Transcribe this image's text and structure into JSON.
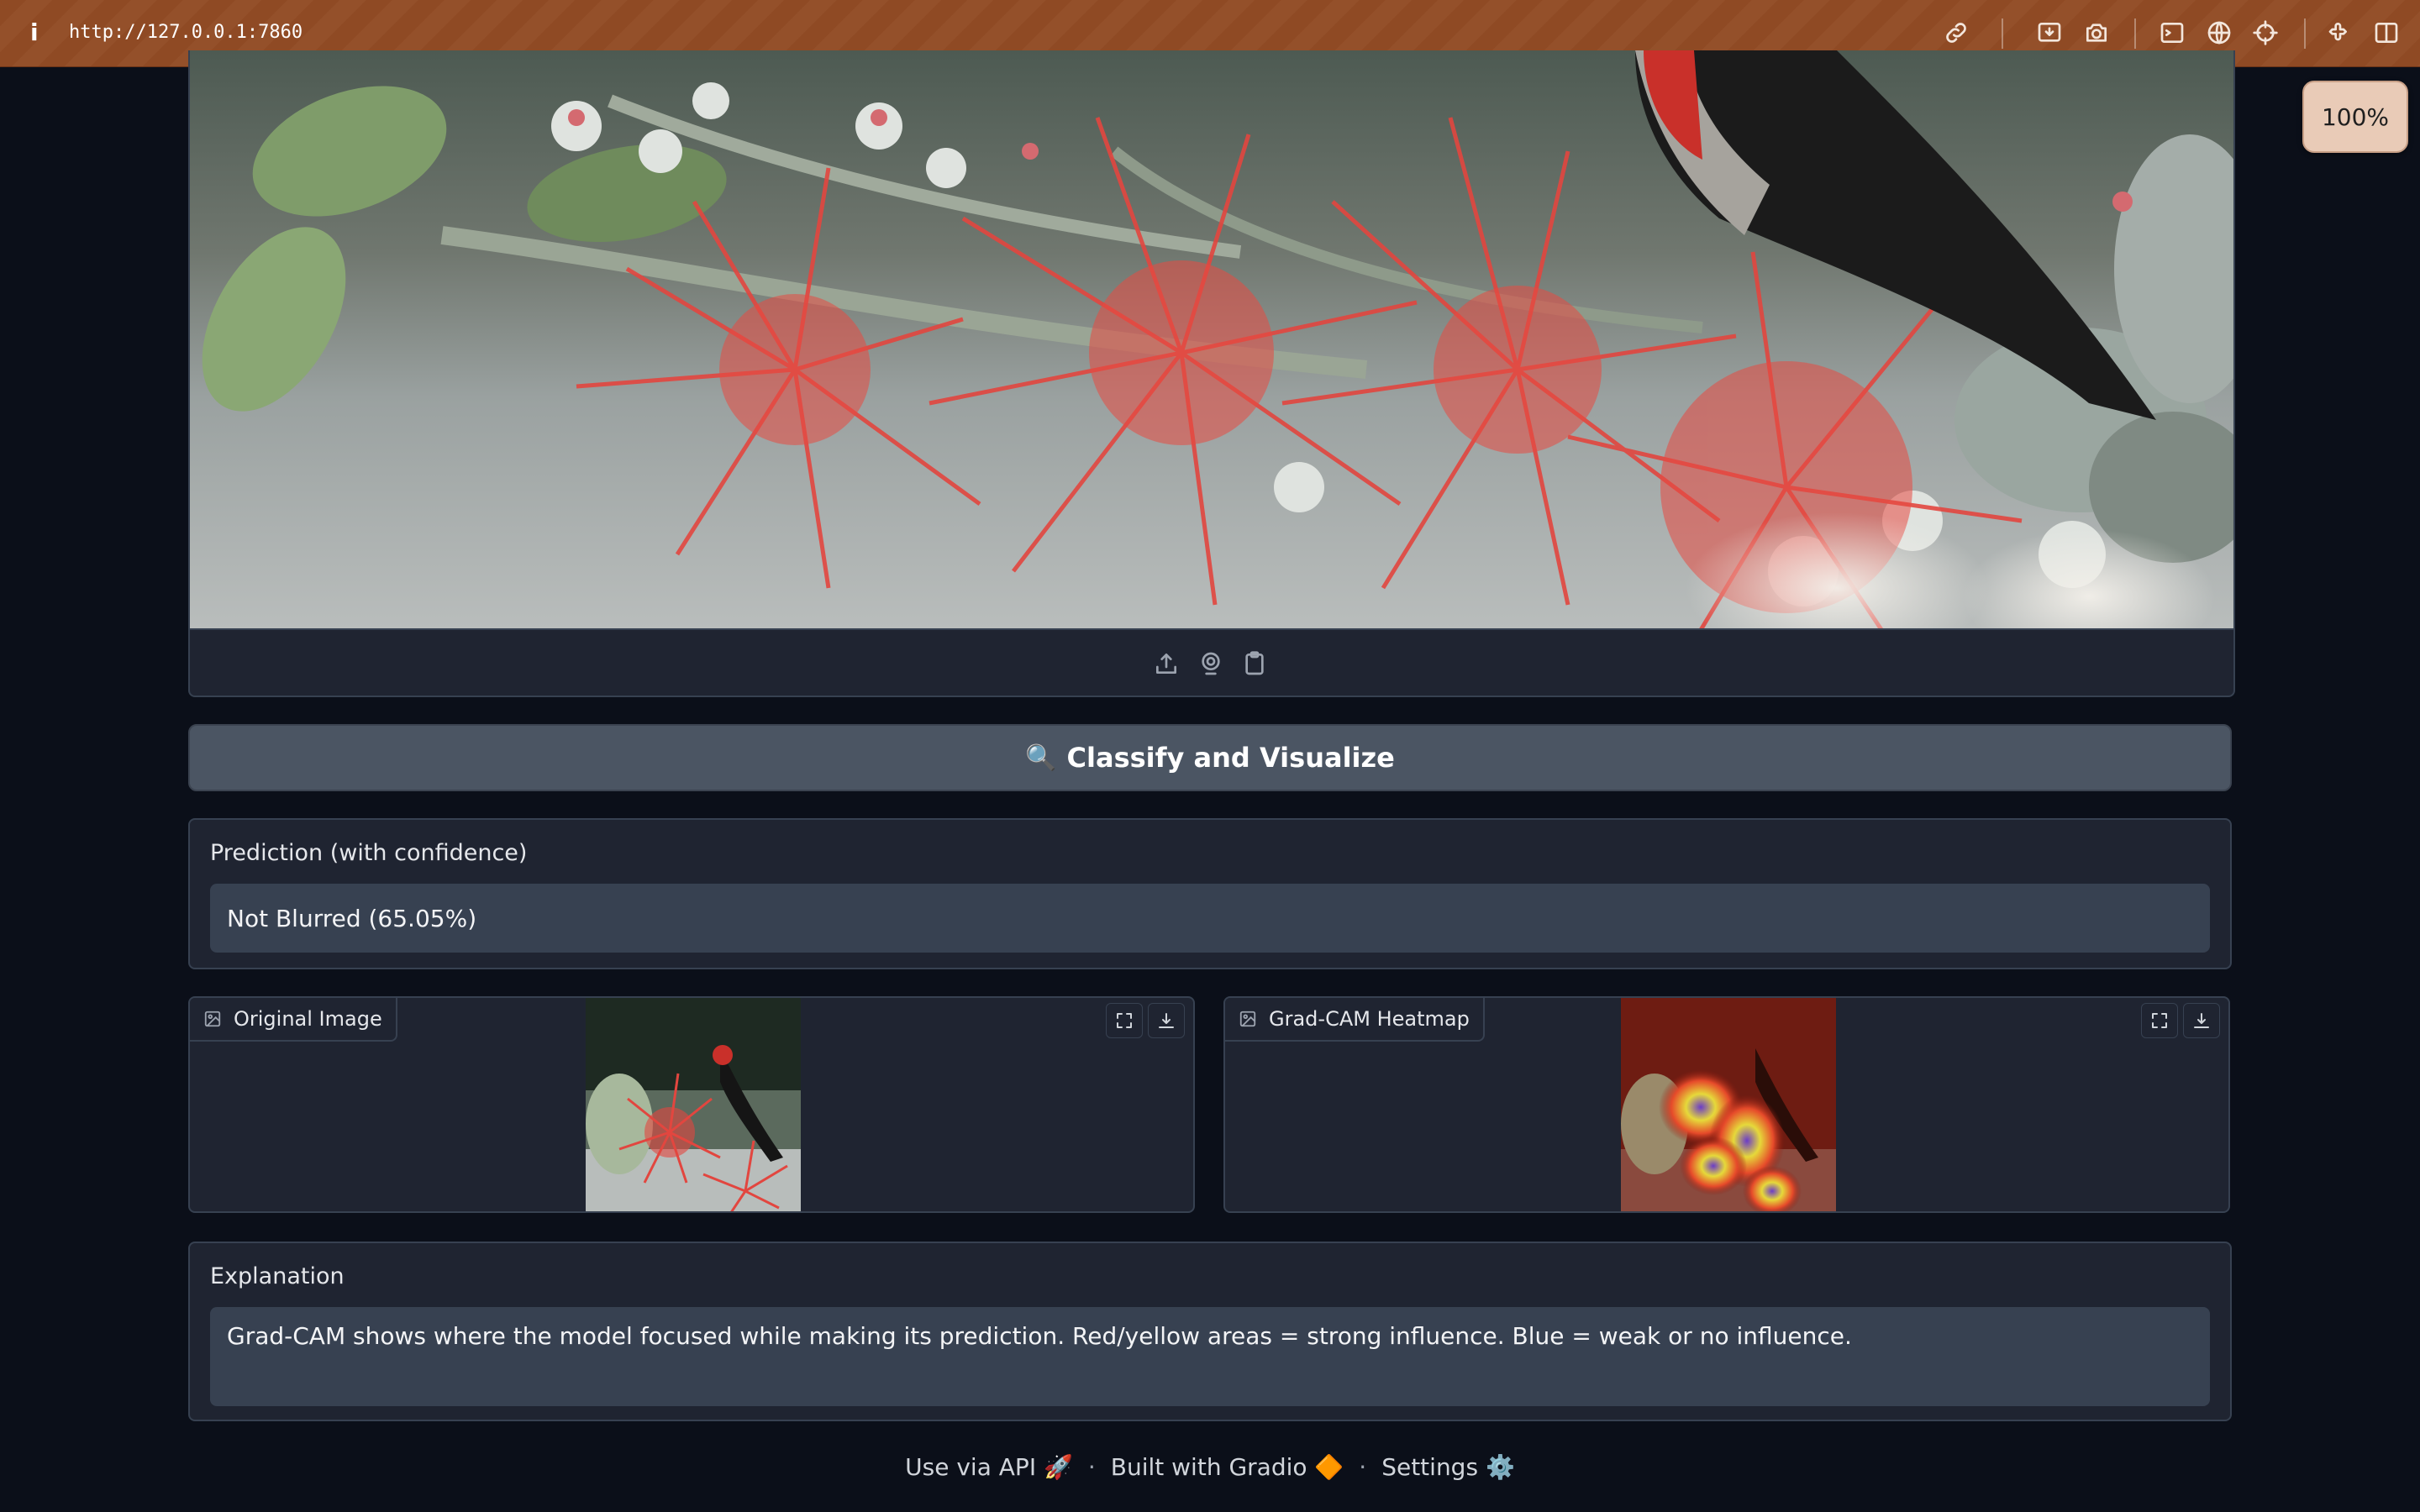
{
  "browser": {
    "info_glyph": "i",
    "url": "http://127.0.0.1:7860",
    "zoom": "100%"
  },
  "classify_button": {
    "icon": "🔍",
    "label": "Classify and Visualize"
  },
  "prediction": {
    "label": "Prediction (with confidence)",
    "value": "Not Blurred (65.05%)"
  },
  "outputs": {
    "original_label": "Original Image",
    "heatmap_label": "Grad-CAM Heatmap"
  },
  "explanation": {
    "label": "Explanation",
    "value": "Grad-CAM shows where the model focused while making its prediction. Red/yellow areas = strong influence. Blue = weak or no influence."
  },
  "footer": {
    "api": "Use via API",
    "api_icon": "🚀",
    "built": "Built with Gradio",
    "built_icon": "🔶",
    "settings": "Settings",
    "settings_icon": "⚙️",
    "separator": "·"
  },
  "colors": {
    "topbar": "#8f4a24",
    "background": "#0b0f19",
    "panel": "#1f2431",
    "border": "#374151",
    "button": "#4b5563"
  }
}
